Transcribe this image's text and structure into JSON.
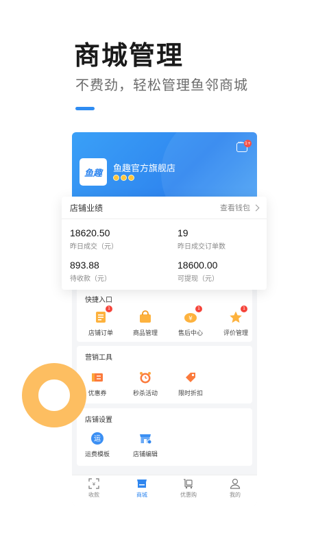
{
  "hero": {
    "title": "商城管理",
    "subtitle": "不费劲，轻松管理鱼邻商城"
  },
  "colors": {
    "accent": "#2f86ef",
    "ring": "#fdb954",
    "badge": "#f5443a"
  },
  "shop": {
    "logo_text": "鱼趣",
    "name": "鱼趣官方旗舰店",
    "message_badge": "1+"
  },
  "stats": {
    "title": "店铺业绩",
    "link": "查看钱包",
    "items": [
      {
        "value": "18620.50",
        "label": "昨日成交（元）"
      },
      {
        "value": "19",
        "label": "昨日成交订单数"
      },
      {
        "value": "893.88",
        "label": "待收款（元）"
      },
      {
        "value": "18600.00",
        "label": "可提现（元）"
      }
    ]
  },
  "quick": {
    "title": "快捷入口",
    "items": [
      {
        "label": "店铺订单",
        "icon": "order-list-icon",
        "badge": "1"
      },
      {
        "label": "商品管理",
        "icon": "shopping-bag-icon",
        "badge": ""
      },
      {
        "label": "售后中心",
        "icon": "after-sale-icon",
        "badge": "1"
      },
      {
        "label": "评价管理",
        "icon": "star-icon",
        "badge": "1"
      }
    ]
  },
  "marketing": {
    "title": "营销工具",
    "items": [
      {
        "label": "优惠券",
        "icon": "coupon-icon"
      },
      {
        "label": "秒杀活动",
        "icon": "alarm-clock-icon"
      },
      {
        "label": "限时折扣",
        "icon": "discount-tag-icon"
      }
    ]
  },
  "settings": {
    "title": "店铺设置",
    "items": [
      {
        "label": "运费模板",
        "icon": "shipping-icon",
        "icon_text": "运"
      },
      {
        "label": "店铺编辑",
        "icon": "shop-edit-icon"
      }
    ]
  },
  "tabbar": {
    "items": [
      {
        "label": "收款",
        "icon": "scan-pay-icon"
      },
      {
        "label": "商城",
        "icon": "store-icon",
        "active": true
      },
      {
        "label": "优惠购",
        "icon": "cart-icon"
      },
      {
        "label": "我的",
        "icon": "user-icon"
      }
    ]
  }
}
